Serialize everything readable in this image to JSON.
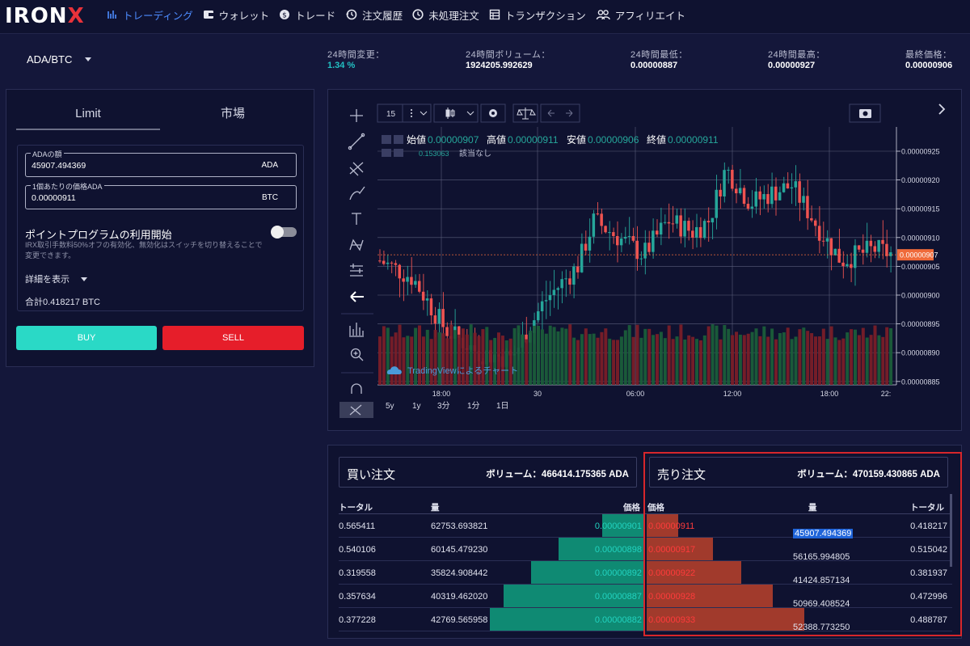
{
  "brand": {
    "text": "IRON",
    "x": "X"
  },
  "nav": [
    {
      "label": "トレーディング",
      "icon": "trading-icon",
      "active": true
    },
    {
      "label": "ウォレット",
      "icon": "wallet-icon"
    },
    {
      "label": "トレード",
      "icon": "trade-icon"
    },
    {
      "label": "注文履歴",
      "icon": "history-icon"
    },
    {
      "label": "未処理注文",
      "icon": "clock-icon"
    },
    {
      "label": "トランザクション",
      "icon": "table-icon"
    },
    {
      "label": "アフィリエイト",
      "icon": "users-icon"
    }
  ],
  "market": {
    "pair": "ADA/BTC",
    "stats": [
      {
        "label": "24時間変更：",
        "value": "1.34 %"
      },
      {
        "label": "24時間ボリューム：",
        "value": "1924205.992629"
      },
      {
        "label": "24時間最低：",
        "value": "0.00000887"
      },
      {
        "label": "24時間最高：",
        "value": "0.00000927"
      },
      {
        "label": "最終価格：",
        "value": "0.00000906"
      }
    ]
  },
  "order": {
    "tabs": [
      "Limit",
      "市場"
    ],
    "amount_label": "ADAの額",
    "amount_value": "45907.494369",
    "amount_unit": "ADA",
    "price_label": "1個あたりの価格ADA",
    "price_value": "0.00000911",
    "price_unit": "BTC",
    "program_title": "ポイントプログラムの利用開始",
    "program_desc": "IRX取引手数料50%オフの有効化、無効化はスイッチを切り替えることで変更できます。",
    "details": "詳細を表示",
    "total": "合計0.418217 BTC",
    "buy": "BUY",
    "sell": "SELL"
  },
  "chart": {
    "interval": "15",
    "ohlc": {
      "open_label": "始値",
      "open": "0.00000907",
      "high_label": "高値",
      "high": "0.00000911",
      "low_label": "安値",
      "low": "0.00000906",
      "close_label": "終値",
      "close": "0.00000911"
    },
    "volume_row": {
      "value": "0.153063",
      "note": "該当なし"
    },
    "watermark": "TradingViewによるチャート",
    "current_price": "0.00000907",
    "y_ticks": [
      "0.00000925",
      "0.00000920",
      "0.00000915",
      "0.00000910",
      "0.00000905",
      "0.00000900",
      "0.00000895",
      "0.00000890",
      "0.00000885"
    ],
    "x_ticks": [
      "18:00",
      "30",
      "06:00",
      "12:00",
      "18:00",
      "22:"
    ],
    "ranges": [
      "5y",
      "1y",
      "3分",
      "1分",
      "1日"
    ],
    "colors": {
      "up": "#26a69a",
      "down": "#ef5350",
      "vol_up": "#1b5e3a",
      "vol_down": "#7a1f28"
    }
  },
  "chart_data": {
    "type": "candlestick",
    "title": "ADA/BTC",
    "x": [
      "18:00",
      "30",
      "06:00",
      "12:00",
      "18:00"
    ],
    "ylim": [
      8.85e-06,
      9.27e-06
    ],
    "last": 9.07e-06
  },
  "book": {
    "buy_title": "買い注文",
    "buy_volume": "ボリューム：466414.175365 ADA",
    "sell_title": "売り注文",
    "sell_volume": "ボリューム：470159.430865 ADA",
    "headers": {
      "total": "トータル",
      "amount": "量",
      "price": "価格"
    },
    "bids": [
      {
        "total": "0.565411",
        "amount": "62753.693821",
        "price": "0.00000901",
        "depth": 0.27
      },
      {
        "total": "0.540106",
        "amount": "60145.479230",
        "price": "0.00000898",
        "depth": 0.55
      },
      {
        "total": "0.319558",
        "amount": "35824.908442",
        "price": "0.00000892",
        "depth": 0.73
      },
      {
        "total": "0.357634",
        "amount": "40319.462020",
        "price": "0.00000887",
        "depth": 0.91
      },
      {
        "total": "0.377228",
        "amount": "42769.565958",
        "price": "0.00000882",
        "depth": 1.0
      }
    ],
    "asks": [
      {
        "price": "0.00000911",
        "amount": "45907.494369",
        "total": "0.418217",
        "depth": 0.2
      },
      {
        "price": "0.00000917",
        "amount": "56165.994805",
        "total": "0.515042",
        "depth": 0.42
      },
      {
        "price": "0.00000922",
        "amount": "41424.857134",
        "total": "0.381937",
        "depth": 0.6
      },
      {
        "price": "0.00000928",
        "amount": "50969.408524",
        "total": "0.472996",
        "depth": 0.8
      },
      {
        "price": "0.00000933",
        "amount": "52388.773250",
        "total": "0.488787",
        "depth": 1.0
      }
    ]
  }
}
